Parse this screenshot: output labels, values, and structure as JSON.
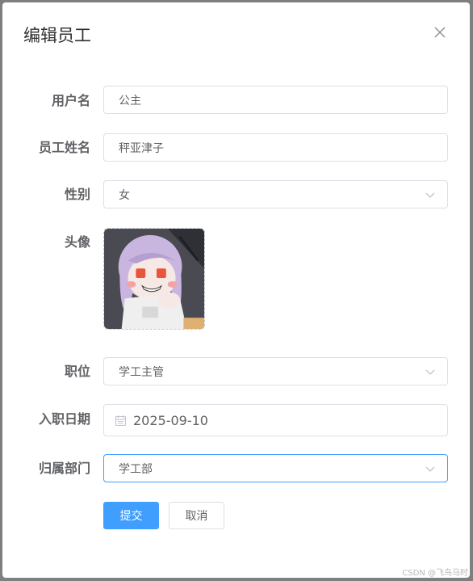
{
  "dialog": {
    "title": "编辑员工",
    "close_icon": "close-icon"
  },
  "form": {
    "username": {
      "label": "用户名",
      "value": "公主"
    },
    "employee_name": {
      "label": "员工姓名",
      "value": "秤亚津子"
    },
    "gender": {
      "label": "性别",
      "value": "女"
    },
    "avatar": {
      "label": "头像"
    },
    "position": {
      "label": "职位",
      "value": "学工主管"
    },
    "hire_date": {
      "label": "入职日期",
      "value": "2025-09-10"
    },
    "department": {
      "label": "归属部门",
      "value": "学工部"
    }
  },
  "buttons": {
    "submit": "提交",
    "cancel": "取消"
  },
  "watermark": "CSDN @飞鸟马时",
  "colors": {
    "primary": "#409eff",
    "border": "#dcdfe6",
    "label": "#606266",
    "title": "#303133"
  }
}
